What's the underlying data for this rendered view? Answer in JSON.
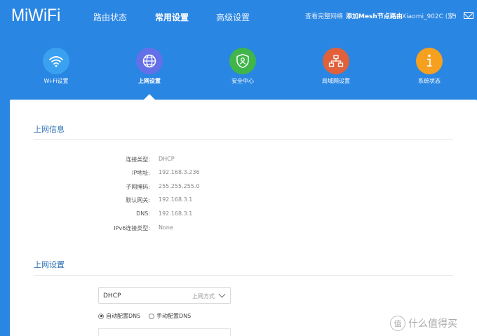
{
  "header": {
    "logo": "MiWiFi",
    "nav": [
      "路由状态",
      "常用设置",
      "高级设置"
    ],
    "active_nav": "常用设置",
    "view_network": "查看完整网络",
    "add_mesh": "添加Mesh节点路由",
    "device": "Xiaomi_902C (家)",
    "icons": {
      "device_dropdown": "chevron-down-icon",
      "mail": "mail-icon"
    }
  },
  "tiles": [
    {
      "label": "Wi-Fi设置",
      "icon": "wifi-icon",
      "color": "#3aa0f0"
    },
    {
      "label": "上网设置",
      "icon": "globe-icon",
      "color": "#6470e8"
    },
    {
      "label": "安全中心",
      "icon": "shield-icon",
      "color": "#3fb54a"
    },
    {
      "label": "局域网设置",
      "icon": "network-icon",
      "color": "#e0613c"
    },
    {
      "label": "系统状态",
      "icon": "info-icon",
      "color": "#f6a020"
    }
  ],
  "active_tile": "上网设置",
  "info": {
    "title": "上网信息",
    "rows": [
      {
        "label": "连接类型:",
        "value": "DHCP"
      },
      {
        "label": "IP地址:",
        "value": "192.168.3.236"
      },
      {
        "label": "子网掩码:",
        "value": "255.255.255.0"
      },
      {
        "label": "默认网关:",
        "value": "192.168.3.1"
      },
      {
        "label": "DNS:",
        "value": "192.168.3.1"
      },
      {
        "label": "IPv6连接类型:",
        "value": "None"
      }
    ]
  },
  "settings": {
    "title": "上网设置",
    "mode_value": "DHCP",
    "mode_hint": "上网方式",
    "dns_auto": "自动配置DNS",
    "dns_manual": "手动配置DNS",
    "dns_selected": "自动配置DNS"
  },
  "watermark": {
    "badge": "值",
    "text": "什么值得买"
  },
  "colors": {
    "brand": "#2a86e3",
    "section_title": "#2a6fb6"
  }
}
